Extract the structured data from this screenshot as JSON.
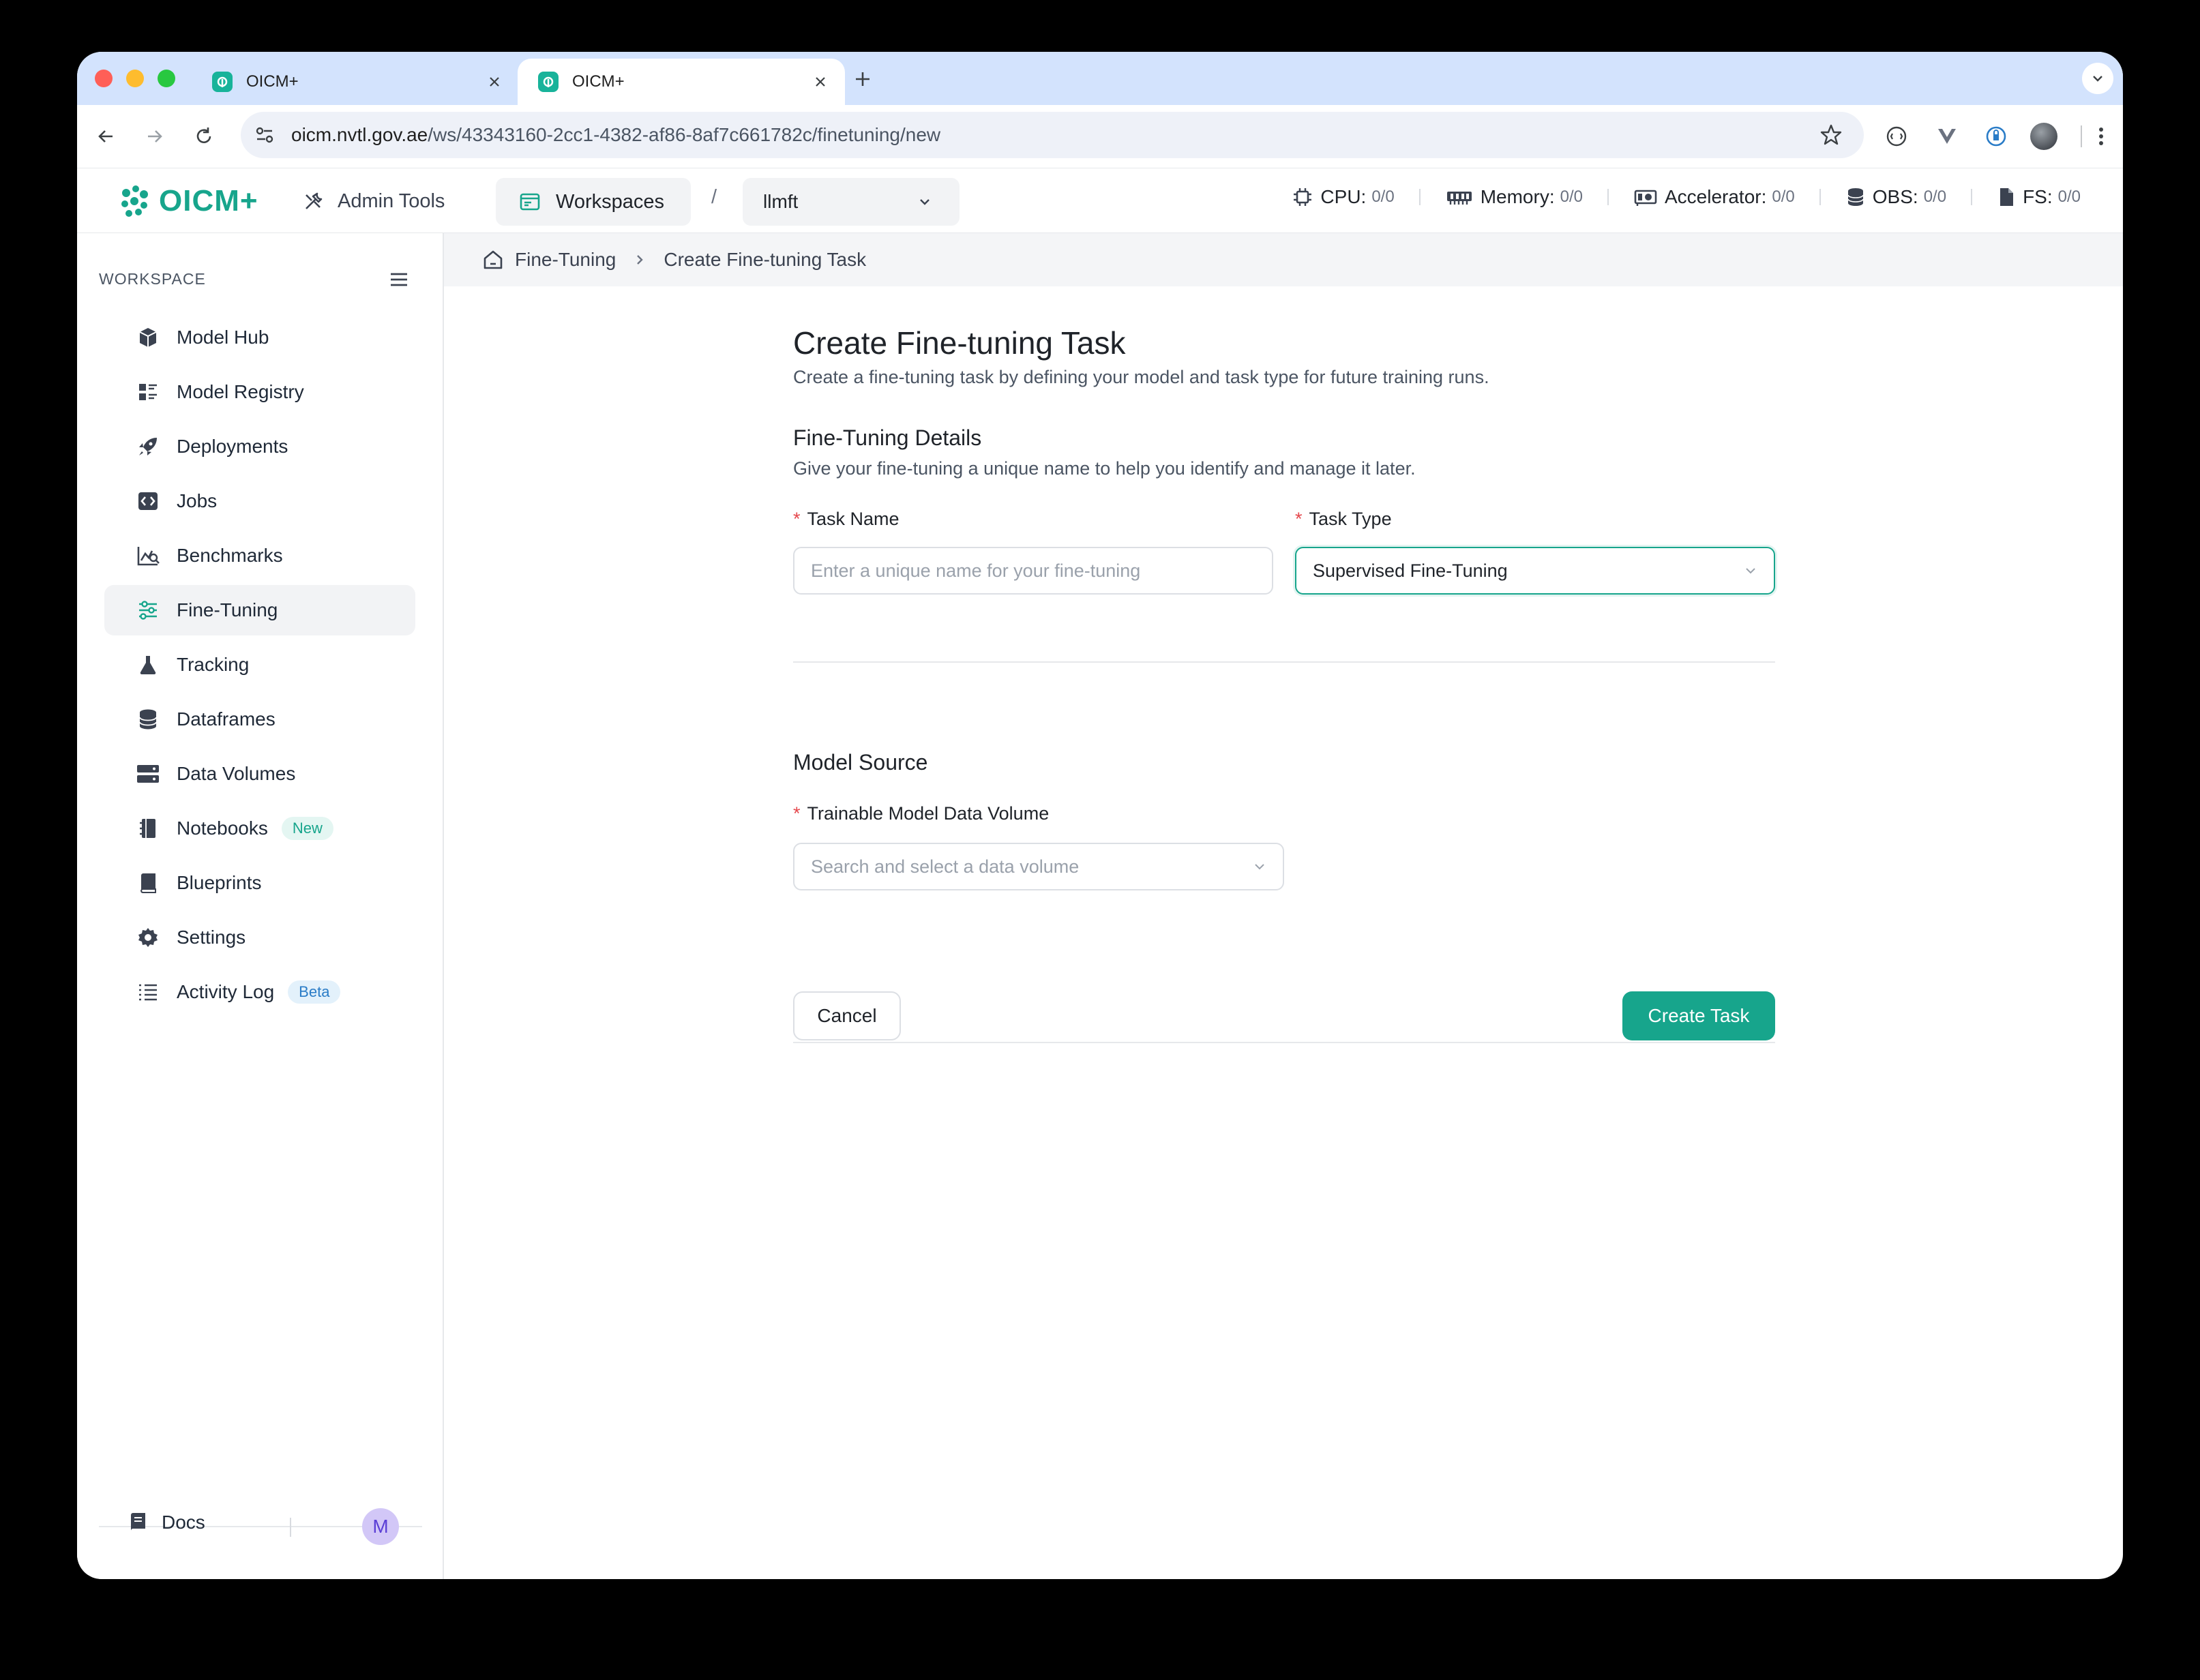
{
  "browser": {
    "tabs": [
      {
        "title": "OICM+"
      },
      {
        "title": "OICM+"
      }
    ],
    "url_host": "oicm.nvtl.gov.ae",
    "url_path": "/ws/43343160-2cc1-4382-af86-8af7c661782c/finetuning/new"
  },
  "header": {
    "logo_text": "OICM+",
    "admin_tools": "Admin Tools",
    "workspaces": "Workspaces",
    "separator": "/",
    "workspace_selected": "llmft",
    "resources": [
      {
        "label": "CPU:",
        "value": "0/0",
        "icon": "cpu-icon"
      },
      {
        "label": "Memory:",
        "value": "0/0",
        "icon": "memory-icon"
      },
      {
        "label": "Accelerator:",
        "value": "0/0",
        "icon": "accelerator-icon"
      },
      {
        "label": "OBS:",
        "value": "0/0",
        "icon": "database-icon"
      },
      {
        "label": "FS:",
        "value": "0/0",
        "icon": "file-icon"
      }
    ]
  },
  "sidebar": {
    "section_label": "WORKSPACE",
    "items": [
      {
        "label": "Model Hub",
        "icon": "cube-icon"
      },
      {
        "label": "Model Registry",
        "icon": "registry-icon"
      },
      {
        "label": "Deployments",
        "icon": "rocket-icon"
      },
      {
        "label": "Jobs",
        "icon": "code-icon"
      },
      {
        "label": "Benchmarks",
        "icon": "chart-search-icon"
      },
      {
        "label": "Fine-Tuning",
        "icon": "sliders-icon",
        "active": true
      },
      {
        "label": "Tracking",
        "icon": "flask-icon"
      },
      {
        "label": "Dataframes",
        "icon": "database-icon"
      },
      {
        "label": "Data Volumes",
        "icon": "volumes-icon"
      },
      {
        "label": "Notebooks",
        "icon": "notebook-icon",
        "badge": "New"
      },
      {
        "label": "Blueprints",
        "icon": "book-icon"
      },
      {
        "label": "Settings",
        "icon": "gear-icon"
      },
      {
        "label": "Activity Log",
        "icon": "list-icon",
        "badge": "Beta"
      }
    ],
    "docs": "Docs",
    "avatar_initial": "M"
  },
  "breadcrumb": {
    "root": "Fine-Tuning",
    "current": "Create Fine-tuning Task"
  },
  "form": {
    "title": "Create Fine-tuning Task",
    "subtitle": "Create a fine-tuning task by defining your model and task type for future training runs.",
    "details_title": "Fine-Tuning Details",
    "details_subtitle": "Give your fine-tuning a unique name to help you identify and manage it later.",
    "task_name_label": "Task Name",
    "task_name_placeholder": "Enter a unique name for your fine-tuning",
    "task_type_label": "Task Type",
    "task_type_value": "Supervised Fine-Tuning",
    "model_source_title": "Model Source",
    "data_volume_label": "Trainable Model Data Volume",
    "data_volume_placeholder": "Search and select a data volume",
    "required_mark": "*",
    "cancel": "Cancel",
    "create": "Create Task"
  },
  "colors": {
    "accent": "#17a58c",
    "tabstrip": "#d3e3fd",
    "required": "#e5484d"
  }
}
